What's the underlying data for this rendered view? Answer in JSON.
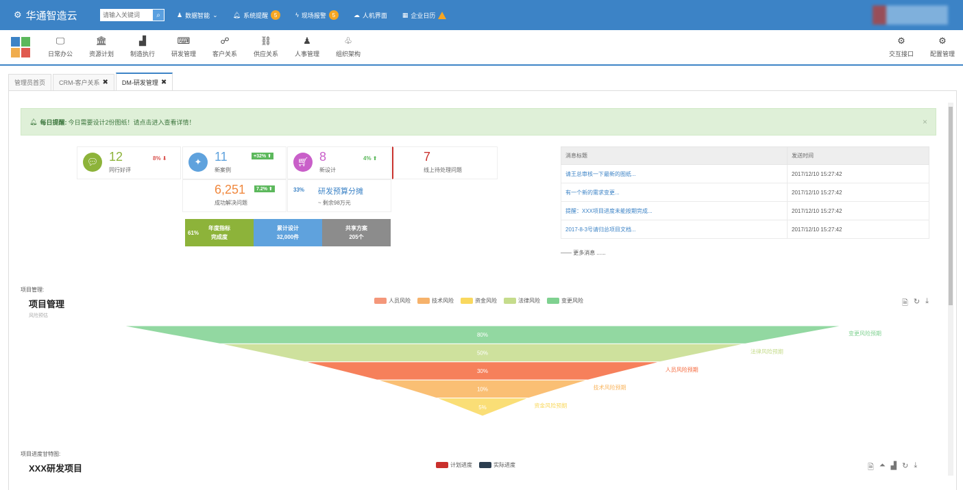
{
  "topbar": {
    "brand": "华通智造云",
    "search_placeholder": "请输入关键词",
    "nav": [
      {
        "label": "数据智能",
        "icon": "user-icon",
        "caret": "⌄"
      },
      {
        "label": "系统提醒",
        "icon": "bell-icon",
        "badge": "5"
      },
      {
        "label": "现场报警",
        "icon": "bolt-icon",
        "badge": "5"
      },
      {
        "label": "人机界面",
        "icon": "cloud-icon"
      },
      {
        "label": "企业日历",
        "icon": "calendar-icon"
      }
    ]
  },
  "toolbar": {
    "items": [
      {
        "label": "日常办公",
        "icon": "monitor-icon",
        "glyph": "🖵"
      },
      {
        "label": "资源计划",
        "icon": "bank-icon",
        "glyph": "🏛"
      },
      {
        "label": "制造执行",
        "icon": "bar-chart-icon",
        "glyph": "▟"
      },
      {
        "label": "研发管理",
        "icon": "keyboard-icon",
        "glyph": "⌨"
      },
      {
        "label": "客户关系",
        "icon": "users-icon",
        "glyph": "☍"
      },
      {
        "label": "供应关系",
        "icon": "link-icon",
        "glyph": "⛓"
      },
      {
        "label": "人事管理",
        "icon": "group-icon",
        "glyph": "♟"
      },
      {
        "label": "组织架构",
        "icon": "sitemap-icon",
        "glyph": "♧"
      }
    ],
    "right": [
      {
        "label": "交互接口",
        "icon": "gear-icon",
        "glyph": "⚙"
      },
      {
        "label": "配置管理",
        "icon": "gear-icon",
        "glyph": "⚙"
      }
    ]
  },
  "tabs": [
    {
      "label": "管理员首页",
      "closable": false
    },
    {
      "label": "CRM-客户关系",
      "closable": true
    },
    {
      "label": "DM-研发管理",
      "closable": true,
      "active": true
    }
  ],
  "alert": {
    "title": "每日提醒:",
    "message": "今日需要设计2份图纸！请点击进入查看详情！",
    "close": "×"
  },
  "stats": {
    "peer_rating": {
      "value": "12",
      "label": "同行好评",
      "change": "8%"
    },
    "new_cases": {
      "value": "11",
      "label": "新案例",
      "change": "+32%"
    },
    "new_designs": {
      "value": "8",
      "label": "新设计",
      "change": "4%"
    },
    "pending": {
      "value": "7",
      "label": "线上待处理问题"
    },
    "solved": {
      "value": "6,251",
      "label": "成功解决问题",
      "change": "7.2%"
    },
    "budget": {
      "pct": "33%",
      "title": "研发预算分摊",
      "sub": "~ 剩余98万元"
    }
  },
  "kpis": [
    {
      "pct": "61%",
      "line1": "年度指标",
      "line2": "完成度",
      "color": "#8db33a"
    },
    {
      "line1": "累计设计",
      "line2": "32,000件",
      "color": "#5fa2dd"
    },
    {
      "line1": "共享方案",
      "line2": "205个",
      "color": "#8c8c8c"
    }
  ],
  "messages": {
    "headers": [
      "消息标题",
      "发送时间"
    ],
    "rows": [
      [
        "请王总审核一下最新的图纸...",
        "2017/12/10 15:27:42"
      ],
      [
        "有一个新的需求变更...",
        "2017/12/10 15:27:42"
      ],
      [
        "提醒：XXX项目进度未能按期完成...",
        "2017/12/10 15:27:42"
      ],
      [
        "2017-8-3号请归总项目文档...",
        "2017/12/10 15:27:42"
      ]
    ],
    "more": "—— 更多消息 ......"
  },
  "project": {
    "label": "项目管理:",
    "title": "项目管理",
    "subtitle": "风险预估",
    "legend": [
      {
        "name": "人员风险",
        "color": "#f4977a"
      },
      {
        "name": "技术风险",
        "color": "#f6b26b"
      },
      {
        "name": "资金风险",
        "color": "#f9d85e"
      },
      {
        "name": "法律风险",
        "color": "#c5dc8c"
      },
      {
        "name": "变更风险",
        "color": "#7fd190"
      }
    ]
  },
  "chart_data": {
    "type": "funnel",
    "series": [
      {
        "name": "变更风险预期",
        "value": 80,
        "label": "80%",
        "color": "#7fd190"
      },
      {
        "name": "法律风险预期",
        "value": 50,
        "label": "50%",
        "color": "#c5dc8c"
      },
      {
        "name": "人员风险预期",
        "value": 30,
        "label": "30%",
        "color": "#f56a3e"
      },
      {
        "name": "技术风险预期",
        "value": 10,
        "label": "10%",
        "color": "#f9b45c"
      },
      {
        "name": "资金风险预期",
        "value": 5,
        "label": "5%",
        "color": "#f9d85e"
      }
    ]
  },
  "gantt": {
    "label": "项目进度甘特图:",
    "title": "XXX研发项目",
    "legend": [
      {
        "name": "计划进度",
        "color": "#c9302c"
      },
      {
        "name": "实际进度",
        "color": "#2c3e50"
      }
    ]
  }
}
